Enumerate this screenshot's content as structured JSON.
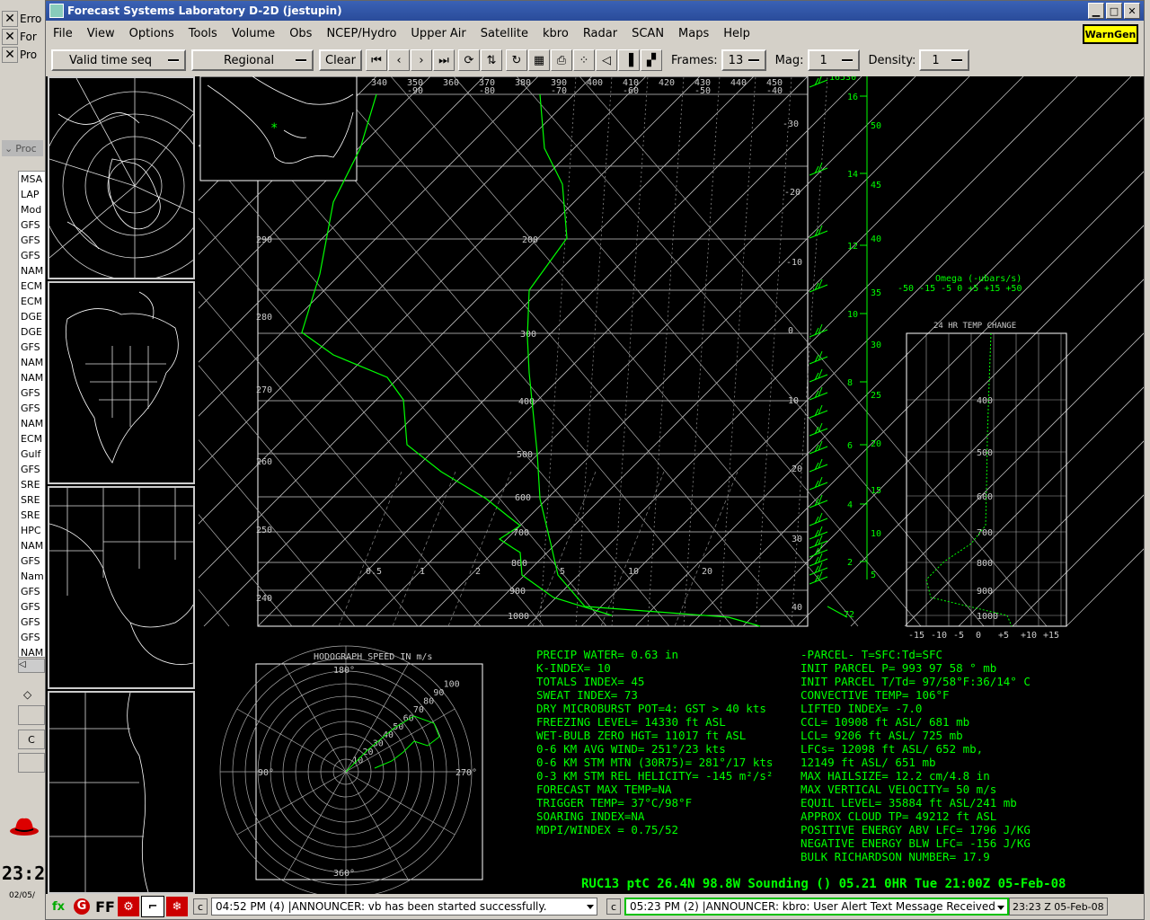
{
  "background": {
    "rows": [
      {
        "label": "Erro"
      },
      {
        "label": "For"
      },
      {
        "label": "Pro"
      }
    ],
    "proc_header": "Proc",
    "proc_items": [
      "MSA",
      "LAP",
      "Mod",
      "GFS",
      "GFS",
      "GFS",
      "NAM",
      "ECM",
      "ECM",
      "DGE",
      "DGE",
      "GFS",
      "NAM",
      "NAM",
      "GFS",
      "GFS",
      "NAM",
      "ECM",
      "Gulf",
      "GFS",
      "SRE",
      "SRE",
      "SRE",
      "HPC",
      "NAM",
      "GFS",
      "Nam",
      "GFS",
      "GFS",
      "GFS",
      "GFS",
      "NAM"
    ],
    "btn_c": "C",
    "clock": "23:2",
    "date": "02/05/"
  },
  "window": {
    "title": "Forecast Systems Laboratory D-2D (jestupin)",
    "menus": [
      "File",
      "View",
      "Options",
      "Tools",
      "Volume",
      "Obs",
      "NCEP/Hydro",
      "Upper Air",
      "Satellite",
      "kbro",
      "Radar",
      "SCAN",
      "Maps",
      "Help"
    ],
    "warngen": "WarnGen"
  },
  "toolbar": {
    "time_seq": "Valid time seq",
    "scale": "Regional",
    "clear": "Clear",
    "frames_label": "Frames:",
    "frames_value": "13",
    "mag_label": "Mag:",
    "mag_value": "1",
    "density_label": "Density:",
    "density_value": "1"
  },
  "sounding": {
    "pressure_labels": [
      "200",
      "300",
      "400",
      "500",
      "600",
      "700",
      "800",
      "900",
      "1000"
    ],
    "temp_labels": [
      "-30",
      "-20",
      "-10",
      "0",
      "10",
      "20",
      "30",
      "40"
    ],
    "theta_labels": [
      "290",
      "280",
      "270",
      "260",
      "250",
      "240"
    ],
    "top_theta": [
      "340",
      "350",
      "360",
      "370",
      "380",
      "390",
      "400",
      "410",
      "420",
      "430",
      "440",
      "450"
    ],
    "top_temps": [
      "-90",
      "-80",
      "-70",
      "-60",
      "-50",
      "-40"
    ],
    "mixing_labels": [
      "0.5",
      "1",
      "2",
      "5",
      "10",
      "20"
    ],
    "height_km": [
      "16",
      "14",
      "12",
      "10",
      "8",
      "6",
      "4",
      "2"
    ],
    "height_kft": [
      "50",
      "45",
      "40",
      "35",
      "30",
      "25",
      "20",
      "15",
      "10",
      "5"
    ],
    "top_height": "16530",
    "bottom_height": "72"
  },
  "omega": {
    "title": "Omega (-ubars/s)",
    "scale": "-50 -15 -5  0  +5 +15 +50",
    "temp_change_title": "24 HR TEMP CHANGE",
    "levels": [
      "400",
      "500",
      "600",
      "700",
      "800",
      "900",
      "1000"
    ],
    "x_labels": [
      "-15",
      "-10",
      "-5",
      "0",
      "+5",
      "+10",
      "+15"
    ]
  },
  "hodograph": {
    "title": "HODOGRAPH SPEED IN m/s",
    "rings": [
      "10",
      "20",
      "30",
      "40",
      "50",
      "60",
      "70",
      "80",
      "90",
      "100"
    ],
    "north": "180°",
    "south": "360°",
    "east": "270°",
    "west": "90°"
  },
  "indices_left": [
    "PRECIP  WATER=  0.63  in",
    "K-INDEX=  10",
    "TOTALS  INDEX=  45",
    "SWEAT  INDEX=  73",
    "DRY  MICROBURST  POT=4:  GST  >  40  kts",
    "FREEZING  LEVEL=  14330  ft  ASL",
    "WET-BULB  ZERO  HGT=  11017  ft  ASL",
    "0-6  KM  AVG  WIND=  251°/23  kts",
    "0-6  KM  STM  MTN  (30R75)=  281°/17  kts",
    "0-3  KM  STM  REL  HELICITY=  -145  m²/s²",
    "FORECAST  MAX  TEMP=NA",
    "TRIGGER  TEMP=  37°C/98°F",
    "SOARING  INDEX=NA",
    "MDPI/WINDEX  =  0.75/52"
  ],
  "indices_right": [
    "-PARCEL-   T=SFC:Td=SFC",
    "INIT  PARCEL  P=  993  97  58  °  mb",
    "INIT  PARCEL  T/Td=  97/58°F:36/14° C",
    "CONVECTIVE  TEMP=  106°F",
    "LIFTED  INDEX=  -7.0",
    "CCL=  10908  ft  ASL/  681  mb",
    "LCL=  9206  ft  ASL/  725  mb",
    "LFCs=  12098  ft  ASL/  652  mb,",
    "       12149  ft  ASL/  651  mb",
    "MAX  HAILSIZE=  12.2  cm/4.8  in",
    "MAX  VERTICAL  VELOCITY=  50  m/s",
    "EQUIL  LEVEL=  35884  ft  ASL/241  mb",
    "APPROX  CLOUD  TP=  49212  ft  ASL",
    "POSITIVE  ENERGY  ABV  LFC=  1796  J/KG",
    "NEGATIVE  ENERGY  BLW  LFC=  -156  J/KG",
    "BULK  RICHARDSON  NUMBER=  17.9"
  ],
  "footer": "RUC13  ptC  26.4N  98.8W  Sounding  ()   05.21    0HR  Tue  21:00Z  05-Feb-08",
  "statusbar": {
    "icon_ff": "FF",
    "msg1_btn": "c",
    "msg1": "04:52 PM (4) |ANNOUNCER: vb has been started successfully.",
    "msg2_btn": "c",
    "msg2": "05:23 PM (2) |ANNOUNCER: kbro: User Alert Text Message Received",
    "time": "23:23 Z 05-Feb-08"
  }
}
